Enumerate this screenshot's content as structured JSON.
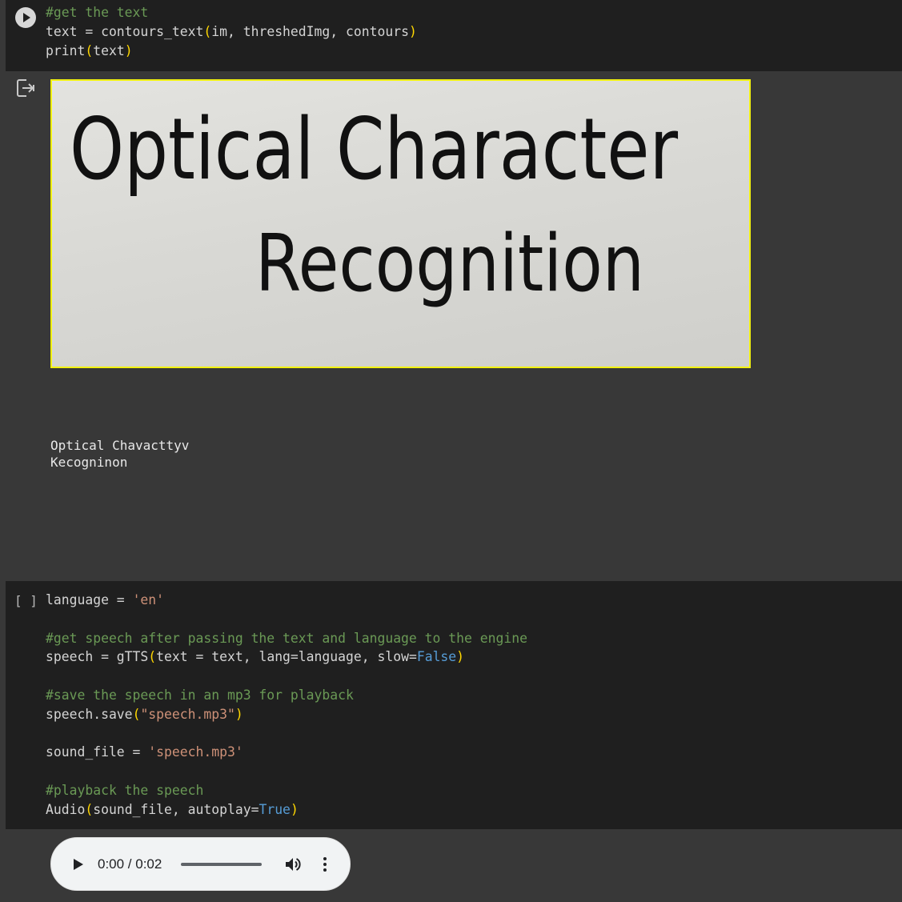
{
  "cell1": {
    "lines": [
      [
        {
          "t": "#get the text",
          "c": "comment"
        }
      ],
      [
        {
          "t": "text = contours_text",
          "c": "plain"
        },
        {
          "t": "(",
          "c": "paren"
        },
        {
          "t": "im, threshedImg, contours",
          "c": "plain"
        },
        {
          "t": ")",
          "c": "paren"
        }
      ],
      [
        {
          "t": "print",
          "c": "plain"
        },
        {
          "t": "(",
          "c": "paren"
        },
        {
          "t": "text",
          "c": "plain"
        },
        {
          "t": ")",
          "c": "paren"
        }
      ]
    ]
  },
  "output": {
    "image": {
      "line1": "Optical Character",
      "line2": "Recognition"
    },
    "text_line1": "Optical Chavacttyv",
    "text_line2": "Kecogninon"
  },
  "cell2": {
    "bracket": "[ ]",
    "lines": [
      [
        {
          "t": "language = ",
          "c": "plain"
        },
        {
          "t": "'en'",
          "c": "string"
        }
      ],
      [],
      [
        {
          "t": "#get speech after passing the text and language to the engine",
          "c": "comment"
        }
      ],
      [
        {
          "t": "speech = gTTS",
          "c": "plain"
        },
        {
          "t": "(",
          "c": "paren"
        },
        {
          "t": "text = text, lang=language, slow=",
          "c": "plain"
        },
        {
          "t": "False",
          "c": "kw"
        },
        {
          "t": ")",
          "c": "paren"
        }
      ],
      [],
      [
        {
          "t": "#save the speech in an mp3 for playback",
          "c": "comment"
        }
      ],
      [
        {
          "t": "speech.save",
          "c": "plain"
        },
        {
          "t": "(",
          "c": "paren"
        },
        {
          "t": "\"speech.mp3\"",
          "c": "string"
        },
        {
          "t": ")",
          "c": "paren"
        }
      ],
      [],
      [
        {
          "t": "sound_file = ",
          "c": "plain"
        },
        {
          "t": "'speech.mp3'",
          "c": "string"
        }
      ],
      [],
      [
        {
          "t": "#playback the speech",
          "c": "comment"
        }
      ],
      [
        {
          "t": "Audio",
          "c": "plain"
        },
        {
          "t": "(",
          "c": "paren"
        },
        {
          "t": "sound_file, autoplay=",
          "c": "plain"
        },
        {
          "t": "True",
          "c": "kw"
        },
        {
          "t": ")",
          "c": "paren"
        }
      ]
    ]
  },
  "audio": {
    "time": "0:00 / 0:02",
    "progress": 0.0
  },
  "icons": {
    "run": "play-circle-icon",
    "output": "output-exit-icon",
    "play": "play-icon",
    "volume": "volume-icon",
    "more": "more-vert-icon"
  }
}
